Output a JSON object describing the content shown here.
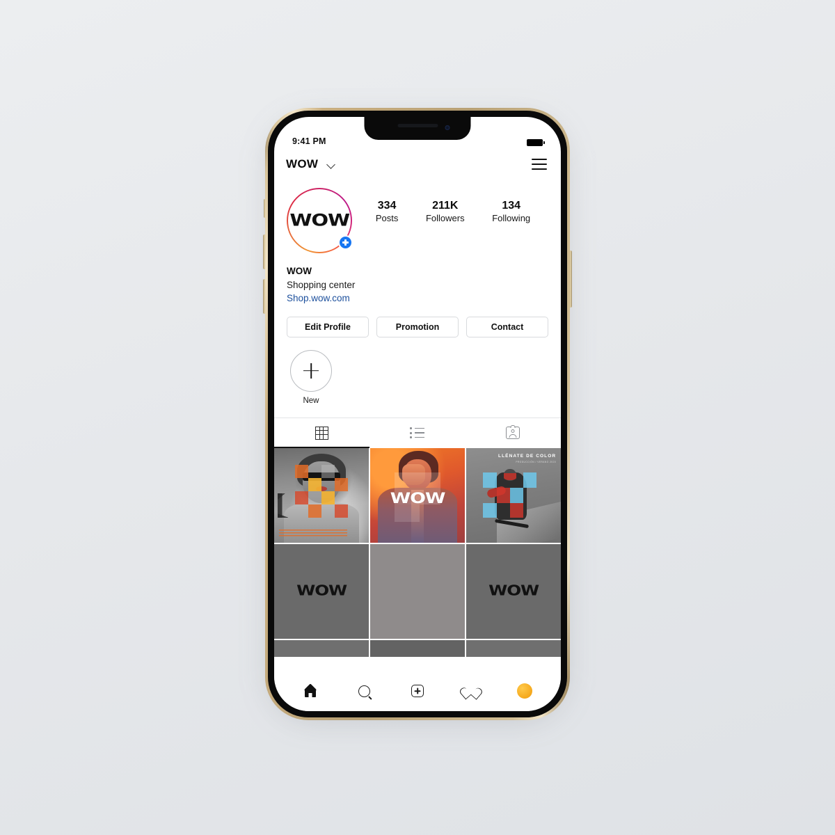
{
  "status_bar": {
    "time": "9:41 PM",
    "battery_icon": "battery-full-icon"
  },
  "header": {
    "username": "WOW",
    "chevron_icon": "chevron-down-icon",
    "menu_icon": "hamburger-menu-icon"
  },
  "profile": {
    "avatar_logo": "WOW",
    "avatar_ring_colors": [
      "#f09433",
      "#dc2743",
      "#bc1888"
    ],
    "add_story_badge": "plus-badge-icon",
    "add_story_badge_color": "#1877f2",
    "stats": [
      {
        "value": "334",
        "label": "Posts"
      },
      {
        "value": "211K",
        "label": "Followers"
      },
      {
        "value": "134",
        "label": "Following"
      }
    ],
    "bio": {
      "name": "WOW",
      "category": "Shopping center",
      "link": "Shop.wow.com",
      "link_color": "#1c4f9c"
    }
  },
  "actions": [
    {
      "label": "Edit Profile"
    },
    {
      "label": "Promotion"
    },
    {
      "label": "Contact"
    }
  ],
  "highlights": [
    {
      "label": "New",
      "icon": "plus-icon"
    }
  ],
  "tabs": [
    {
      "icon": "grid-icon",
      "active": true
    },
    {
      "icon": "list-icon",
      "active": false
    },
    {
      "icon": "tagged-icon",
      "active": false
    }
  ],
  "posts": [
    {
      "id": "post-1",
      "type": "photo-checker",
      "overlay_text": "",
      "caption": "lorem-caption-lines",
      "accent": "#e26c28"
    },
    {
      "id": "post-2",
      "type": "photo-logo",
      "overlay_text": "WOW",
      "caption": "",
      "accent": "#f07a26"
    },
    {
      "id": "post-3",
      "type": "photo-title",
      "overlay_text": "LLÉNATE DE COLOR",
      "caption": "PRODUCCIÓN / VERANO 2020",
      "accent": "#5bc8e8"
    },
    {
      "id": "post-4",
      "type": "placeholder",
      "overlay_text": "WOW",
      "caption": "",
      "accent": "#6a6a6a"
    },
    {
      "id": "post-5",
      "type": "placeholder",
      "overlay_text": "",
      "caption": "",
      "accent": "#8f8b8b"
    },
    {
      "id": "post-6",
      "type": "placeholder",
      "overlay_text": "WOW",
      "caption": "",
      "accent": "#6a6a6a"
    }
  ],
  "bottom_nav": [
    {
      "icon": "home-icon",
      "active": true
    },
    {
      "icon": "search-icon",
      "active": false
    },
    {
      "icon": "add-post-icon",
      "active": false
    },
    {
      "icon": "heart-icon",
      "active": false
    },
    {
      "icon": "profile-avatar-icon",
      "active": false,
      "color": "#f5a81c"
    }
  ]
}
